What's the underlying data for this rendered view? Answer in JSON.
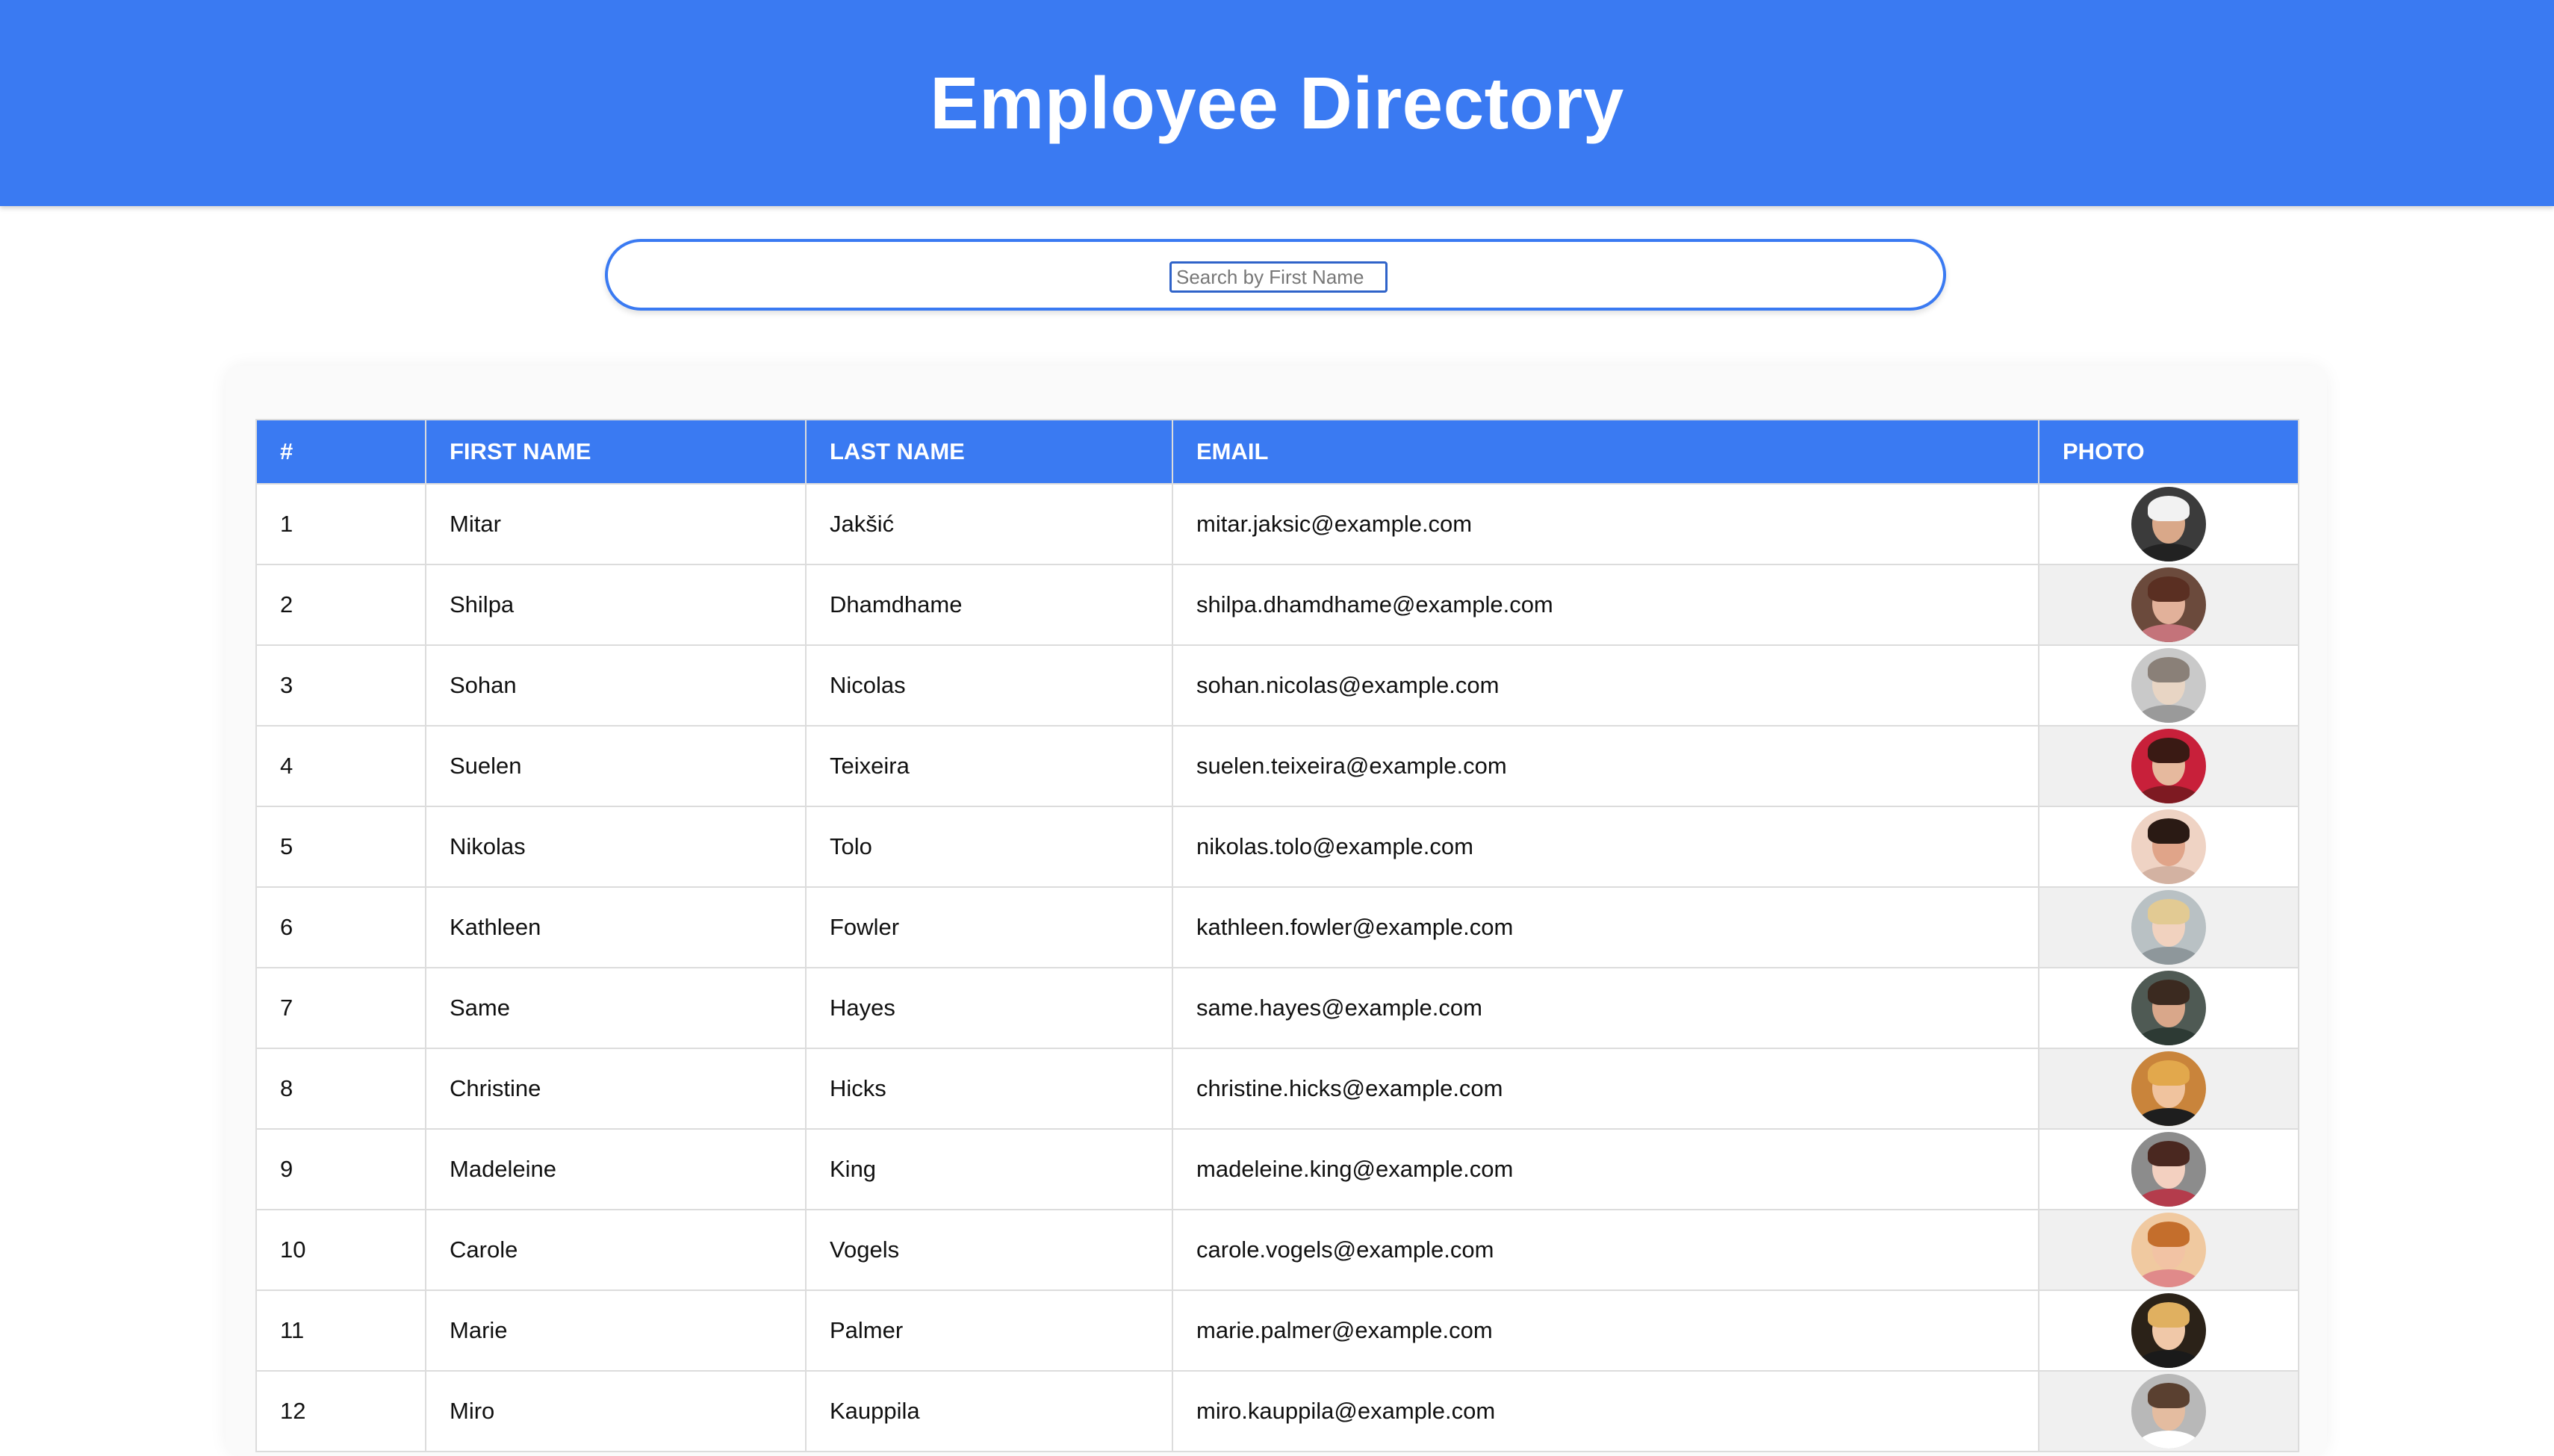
{
  "header": {
    "title": "Employee Directory"
  },
  "search": {
    "placeholder": "Search by First Name"
  },
  "table": {
    "columns": [
      "#",
      "FIRST NAME",
      "LAST NAME",
      "EMAIL",
      "PHOTO"
    ],
    "rows": [
      {
        "id": "1",
        "first": "Mitar",
        "last": "Jakšić",
        "email": "mitar.jaksic@example.com",
        "photo": {
          "bg": "#3b3b3b",
          "hair": "#f2f2f2",
          "skin": "#d9a889",
          "shirt": "#222222"
        }
      },
      {
        "id": "2",
        "first": "Shilpa",
        "last": "Dhamdhame",
        "email": "shilpa.dhamdhame@example.com",
        "photo": {
          "bg": "#6b4a3c",
          "hair": "#5a2f22",
          "skin": "#e2b19a",
          "shirt": "#c4737a"
        }
      },
      {
        "id": "3",
        "first": "Sohan",
        "last": "Nicolas",
        "email": "sohan.nicolas@example.com",
        "photo": {
          "bg": "#c9c9c9",
          "hair": "#8a8078",
          "skin": "#e8d5c4",
          "shirt": "#9a9a9a"
        }
      },
      {
        "id": "4",
        "first": "Suelen",
        "last": "Teixeira",
        "email": "suelen.teixeira@example.com",
        "photo": {
          "bg": "#c8203a",
          "hair": "#3a1a14",
          "skin": "#e6b99e",
          "shirt": "#7e1a22"
        }
      },
      {
        "id": "5",
        "first": "Nikolas",
        "last": "Tolo",
        "email": "nikolas.tolo@example.com",
        "photo": {
          "bg": "#efd3c4",
          "hair": "#2a1a14",
          "skin": "#e0a489",
          "shirt": "#d3b2a2"
        }
      },
      {
        "id": "6",
        "first": "Kathleen",
        "last": "Fowler",
        "email": "kathleen.fowler@example.com",
        "photo": {
          "bg": "#b9c1c4",
          "hair": "#e2ca93",
          "skin": "#f1d2bf",
          "shirt": "#8e979b"
        }
      },
      {
        "id": "7",
        "first": "Same",
        "last": "Hayes",
        "email": "same.hayes@example.com",
        "photo": {
          "bg": "#4f5a54",
          "hair": "#3b2a20",
          "skin": "#d9a78a",
          "shirt": "#2d3a34"
        }
      },
      {
        "id": "8",
        "first": "Christine",
        "last": "Hicks",
        "email": "christine.hicks@example.com",
        "photo": {
          "bg": "#c9843b",
          "hair": "#e2a84c",
          "skin": "#f0c39e",
          "shirt": "#1e1e1e"
        }
      },
      {
        "id": "9",
        "first": "Madeleine",
        "last": "King",
        "email": "madeleine.king@example.com",
        "photo": {
          "bg": "#8c8c8c",
          "hair": "#4a2820",
          "skin": "#f3d0c0",
          "shirt": "#b43c4c"
        }
      },
      {
        "id": "10",
        "first": "Carole",
        "last": "Vogels",
        "email": "carole.vogels@example.com",
        "photo": {
          "bg": "#f0c9a0",
          "hair": "#c46e2c",
          "skin": "#f2c3a4",
          "shirt": "#e08a8a"
        }
      },
      {
        "id": "11",
        "first": "Marie",
        "last": "Palmer",
        "email": "marie.palmer@example.com",
        "photo": {
          "bg": "#2b2218",
          "hair": "#e0b060",
          "skin": "#f0c8a8",
          "shirt": "#1a1a1a"
        }
      },
      {
        "id": "12",
        "first": "Miro",
        "last": "Kauppila",
        "email": "miro.kauppila@example.com",
        "photo": {
          "bg": "#b8b8b8",
          "hair": "#5a4030",
          "skin": "#e4bca0",
          "shirt": "#ffffff"
        }
      }
    ]
  }
}
